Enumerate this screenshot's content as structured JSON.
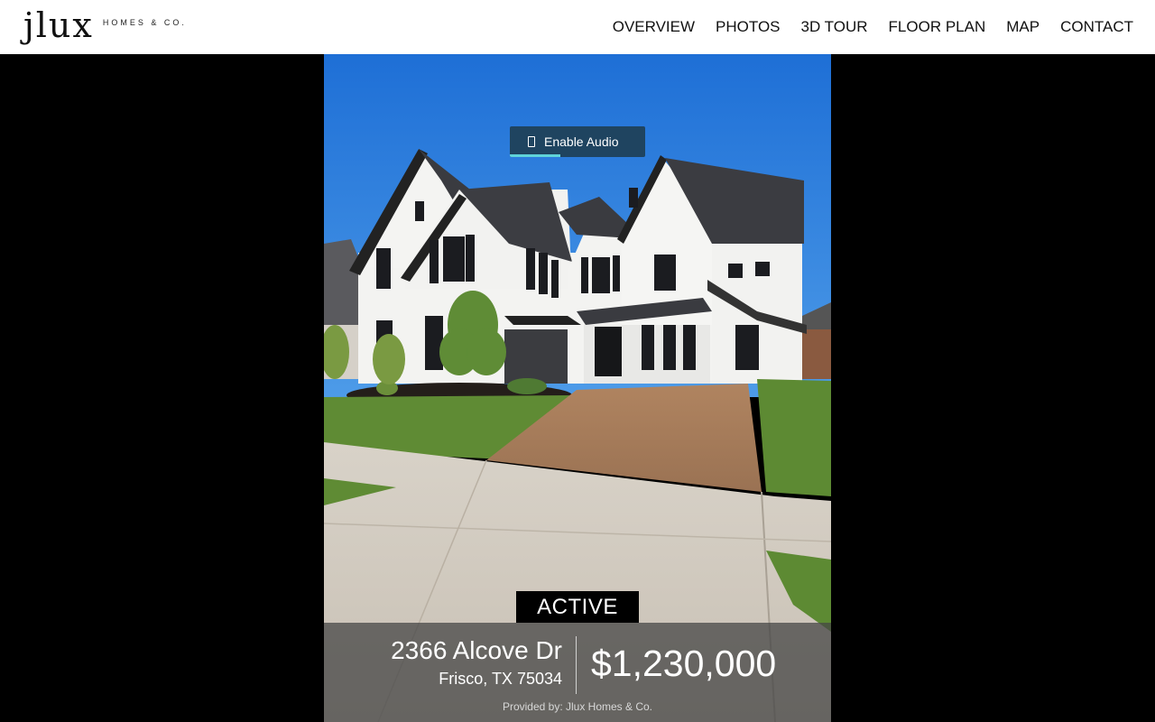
{
  "brand": {
    "name": "jlux",
    "tagline": "HOMES & CO."
  },
  "nav": {
    "items": [
      {
        "label": "OVERVIEW"
      },
      {
        "label": "PHOTOS"
      },
      {
        "label": "3D TOUR"
      },
      {
        "label": "FLOOR PLAN"
      },
      {
        "label": "MAP"
      },
      {
        "label": "CONTACT"
      }
    ]
  },
  "video": {
    "audio_button_label": "Enable Audio",
    "audio_icon": "phone-icon",
    "audio_progress": 0.37
  },
  "listing": {
    "status": "ACTIVE",
    "street": "2366 Alcove Dr",
    "city_state_zip": "Frisco, TX 75034",
    "price": "$1,230,000",
    "provided_by": "Provided by: Jlux Homes & Co."
  },
  "colors": {
    "accent": "#5fd3d9",
    "audio_button_bg": "#1f4460"
  }
}
